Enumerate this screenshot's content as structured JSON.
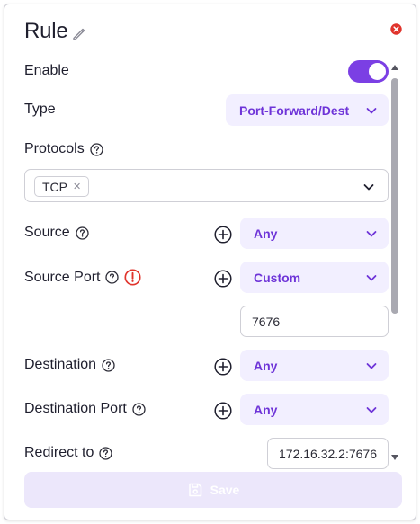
{
  "header": {
    "title": "Rule"
  },
  "fields": {
    "enable": {
      "label": "Enable",
      "value": true
    },
    "type": {
      "label": "Type",
      "value": "Port-Forward/Dest"
    },
    "protocols": {
      "label": "Protocols",
      "chips": [
        "TCP"
      ]
    },
    "source": {
      "label": "Source",
      "value": "Any"
    },
    "source_port": {
      "label": "Source Port",
      "value": "Custom",
      "custom_value": "7676"
    },
    "destination": {
      "label": "Destination",
      "value": "Any"
    },
    "destination_port": {
      "label": "Destination Port",
      "value": "Any"
    },
    "redirect_to": {
      "label": "Redirect to",
      "value": "172.16.32.2:7676"
    }
  },
  "footer": {
    "save_label": "Save"
  },
  "colors": {
    "accent": "#7b3fe4",
    "select_bg": "#f2efff",
    "select_text": "#6e34d8",
    "close_red": "#e0342c",
    "save_disabled_bg": "#ece7fb"
  }
}
